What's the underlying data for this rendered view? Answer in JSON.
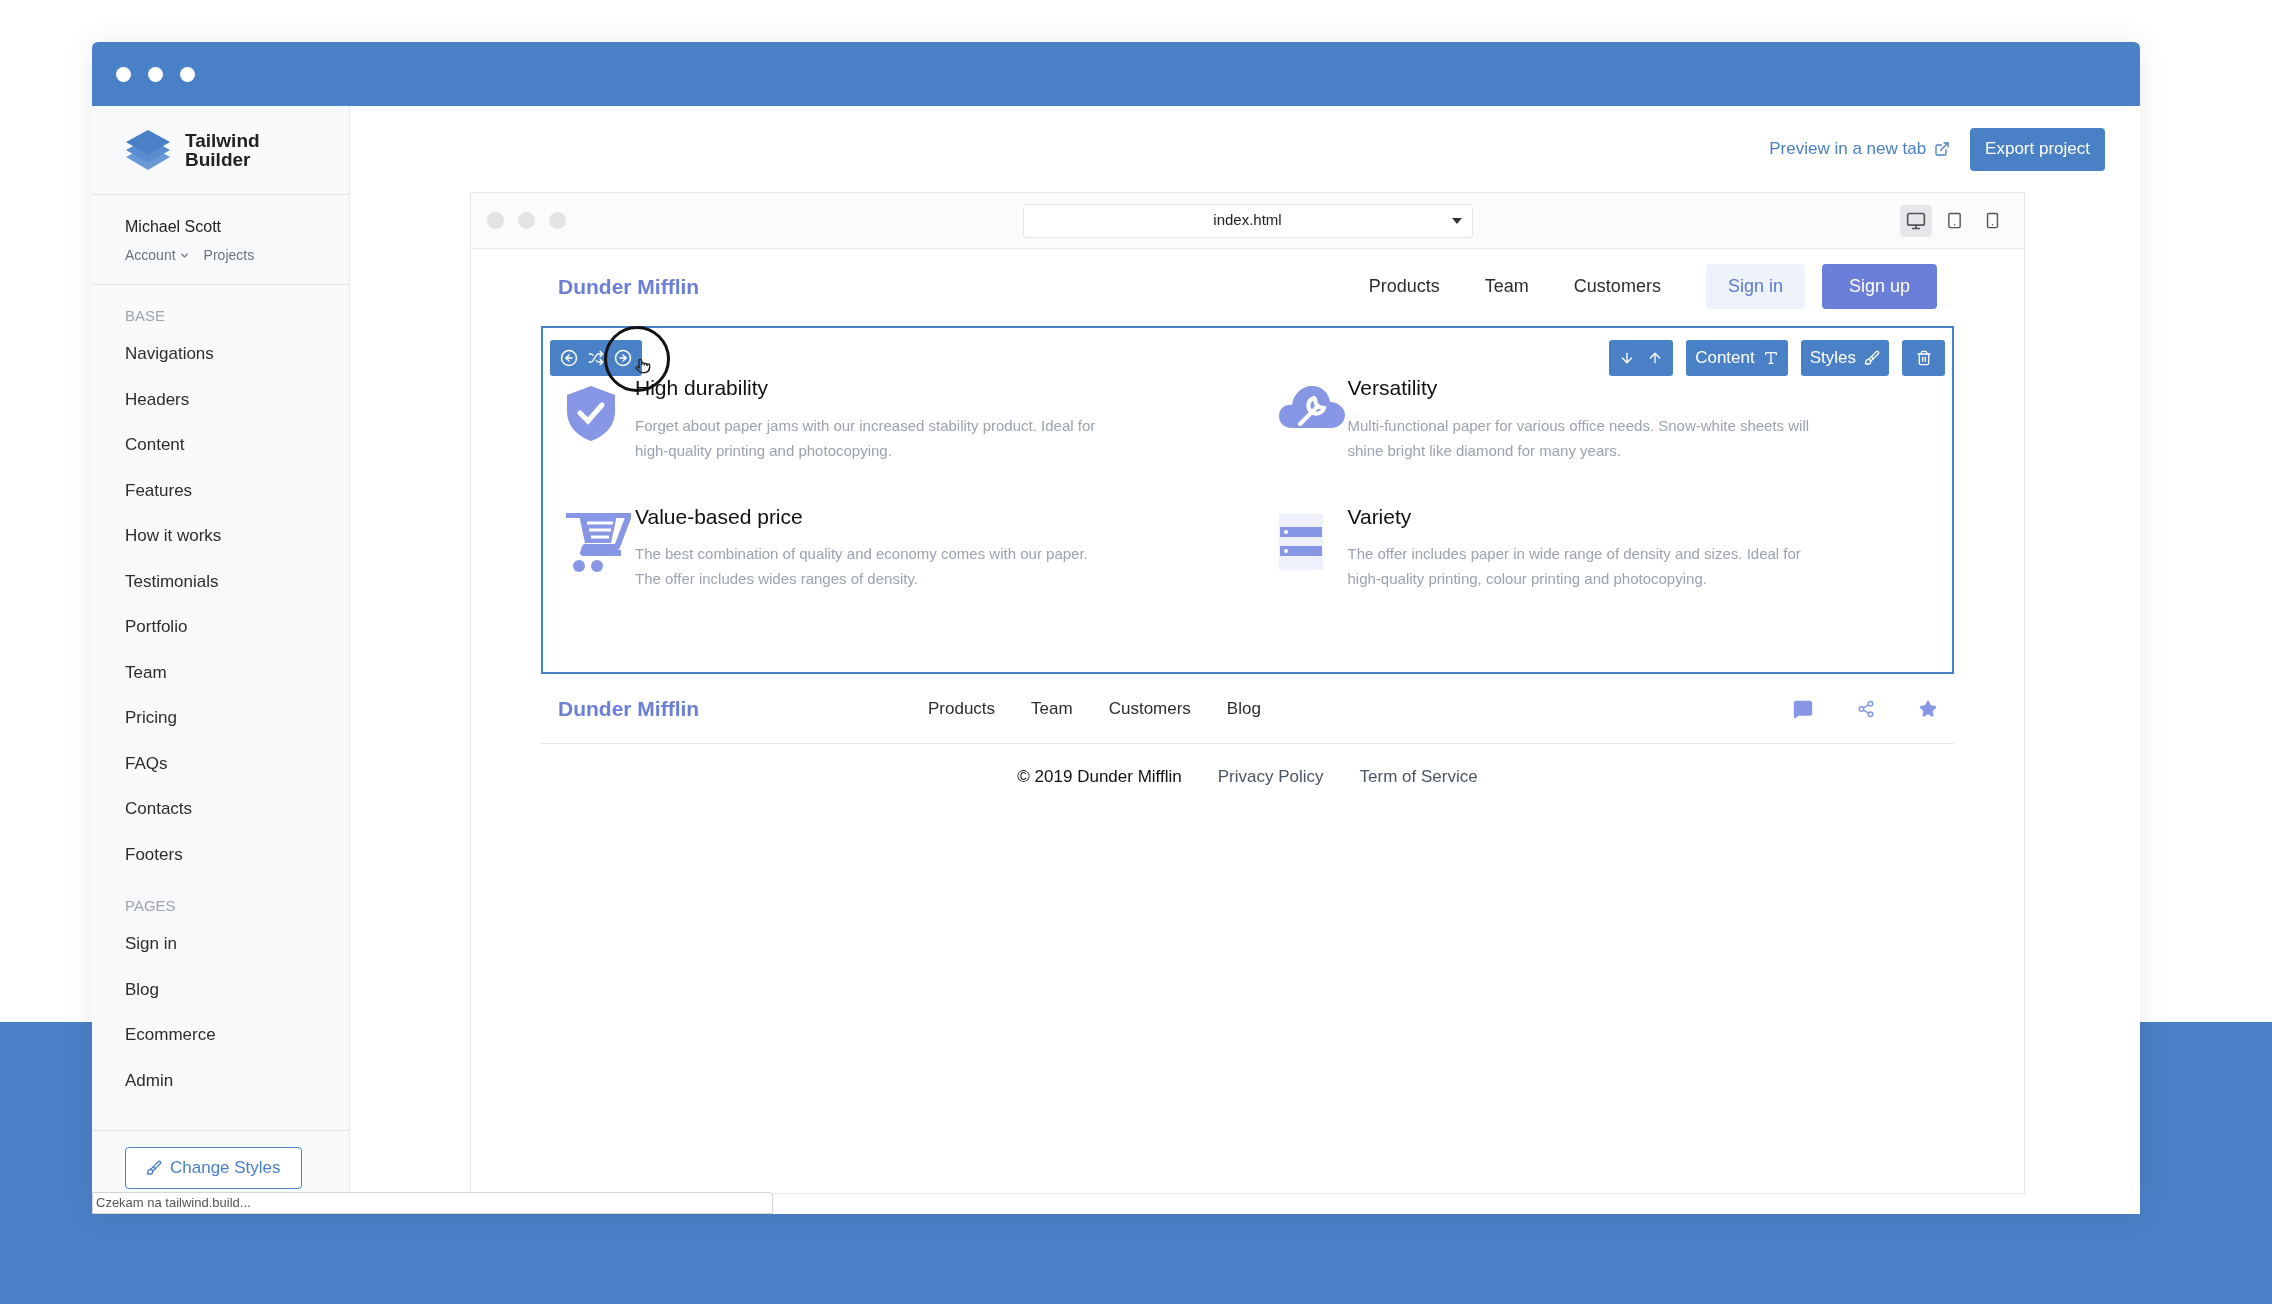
{
  "sidebar": {
    "logo_lines": [
      "Tailwind",
      "Builder"
    ],
    "user": {
      "name": "Michael Scott",
      "links": [
        {
          "label": "Account",
          "dropdown": true
        },
        {
          "label": "Projects",
          "dropdown": false
        }
      ]
    },
    "sections": [
      {
        "heading": "BASE",
        "items": [
          "Navigations",
          "Headers",
          "Content",
          "Features",
          "How it works",
          "Testimonials",
          "Portfolio",
          "Team",
          "Pricing",
          "FAQs",
          "Contacts",
          "Footers"
        ]
      },
      {
        "heading": "PAGES",
        "items": [
          "Sign in",
          "Blog",
          "Ecommerce",
          "Admin"
        ]
      }
    ],
    "change_styles_button": "Change Styles"
  },
  "topbar": {
    "preview_link": "Preview in a new tab",
    "export_button": "Export project"
  },
  "preview": {
    "file_select": "index.html",
    "devices": [
      {
        "kind": "desktop",
        "selected": true
      },
      {
        "kind": "tablet",
        "selected": false
      },
      {
        "kind": "phone",
        "selected": false
      }
    ]
  },
  "page": {
    "brand": "Dunder Mifflin",
    "nav": [
      "Products",
      "Team",
      "Customers"
    ],
    "sign_in": "Sign in",
    "sign_up": "Sign up",
    "block_toolbar": {
      "content_button": "Content",
      "styles_button": "Styles"
    },
    "features": [
      {
        "kind": "shield",
        "title": "High durability",
        "description": "Forget about paper jams with our increased stability product. Ideal for high-quality printing and photocopying."
      },
      {
        "kind": "cloud",
        "title": "Versatility",
        "description": "Multi-functional paper for various office needs. Snow-white sheets will shine bright like diamond for many years."
      },
      {
        "kind": "cart",
        "title": "Value-based price",
        "description": "The best combination of quality and economy comes with our paper. The offer includes wides ranges of density."
      },
      {
        "kind": "server",
        "title": "Variety",
        "description": "The offer includes paper in wide range of density and sizes. Ideal for high-quality printing, colour printing and photocopying."
      }
    ],
    "footer": {
      "brand": "Dunder Mifflin",
      "links": [
        "Products",
        "Team",
        "Customers",
        "Blog"
      ],
      "copyright": "© 2019 Dunder Mifflin",
      "legal_links": [
        "Privacy Policy",
        "Term of Service"
      ]
    }
  },
  "status_bar": "Czekam na tailwind.build..."
}
